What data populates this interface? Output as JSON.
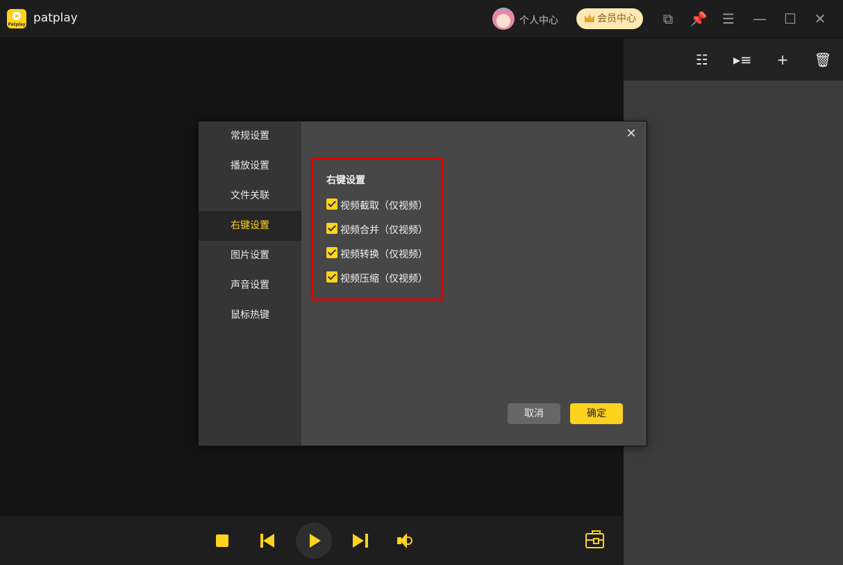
{
  "app": {
    "logo_text": "Patplay",
    "title": "patplay",
    "profile_label": "个人中心",
    "vip_label": "会员中心",
    "accent": "#ffd21e"
  },
  "titlebar_icons": [
    "mini-mode-icon",
    "pin-icon",
    "menu-icon",
    "minimize-icon",
    "maximize-icon",
    "close-icon"
  ],
  "titlebar_glyphs": {
    "mini": "⧉",
    "pin": "📌",
    "menu": "☰",
    "minimize": "—",
    "maximize": "☐",
    "close": "✕"
  },
  "playlist_icons": [
    "list-view-icon",
    "play-list-icon",
    "add-icon",
    "delete-icon"
  ],
  "playlist_glyphs": {
    "list": "☷",
    "playlist": "▸≡",
    "add": "+",
    "delete": "🗑"
  },
  "dialog": {
    "nav": [
      "常规设置",
      "播放设置",
      "文件关联",
      "右键设置",
      "图片设置",
      "声音设置",
      "鼠标热键"
    ],
    "active_nav": "右键设置",
    "close_glyph": "✕",
    "section_title": "右键设置",
    "options": [
      {
        "label": "视频截取（仅视频）",
        "checked": true
      },
      {
        "label": "视频合并（仅视频）",
        "checked": true
      },
      {
        "label": "视频转换（仅视频）",
        "checked": true
      },
      {
        "label": "视频压缩（仅视频）",
        "checked": true
      }
    ],
    "cancel_label": "取消",
    "ok_label": "确定"
  }
}
